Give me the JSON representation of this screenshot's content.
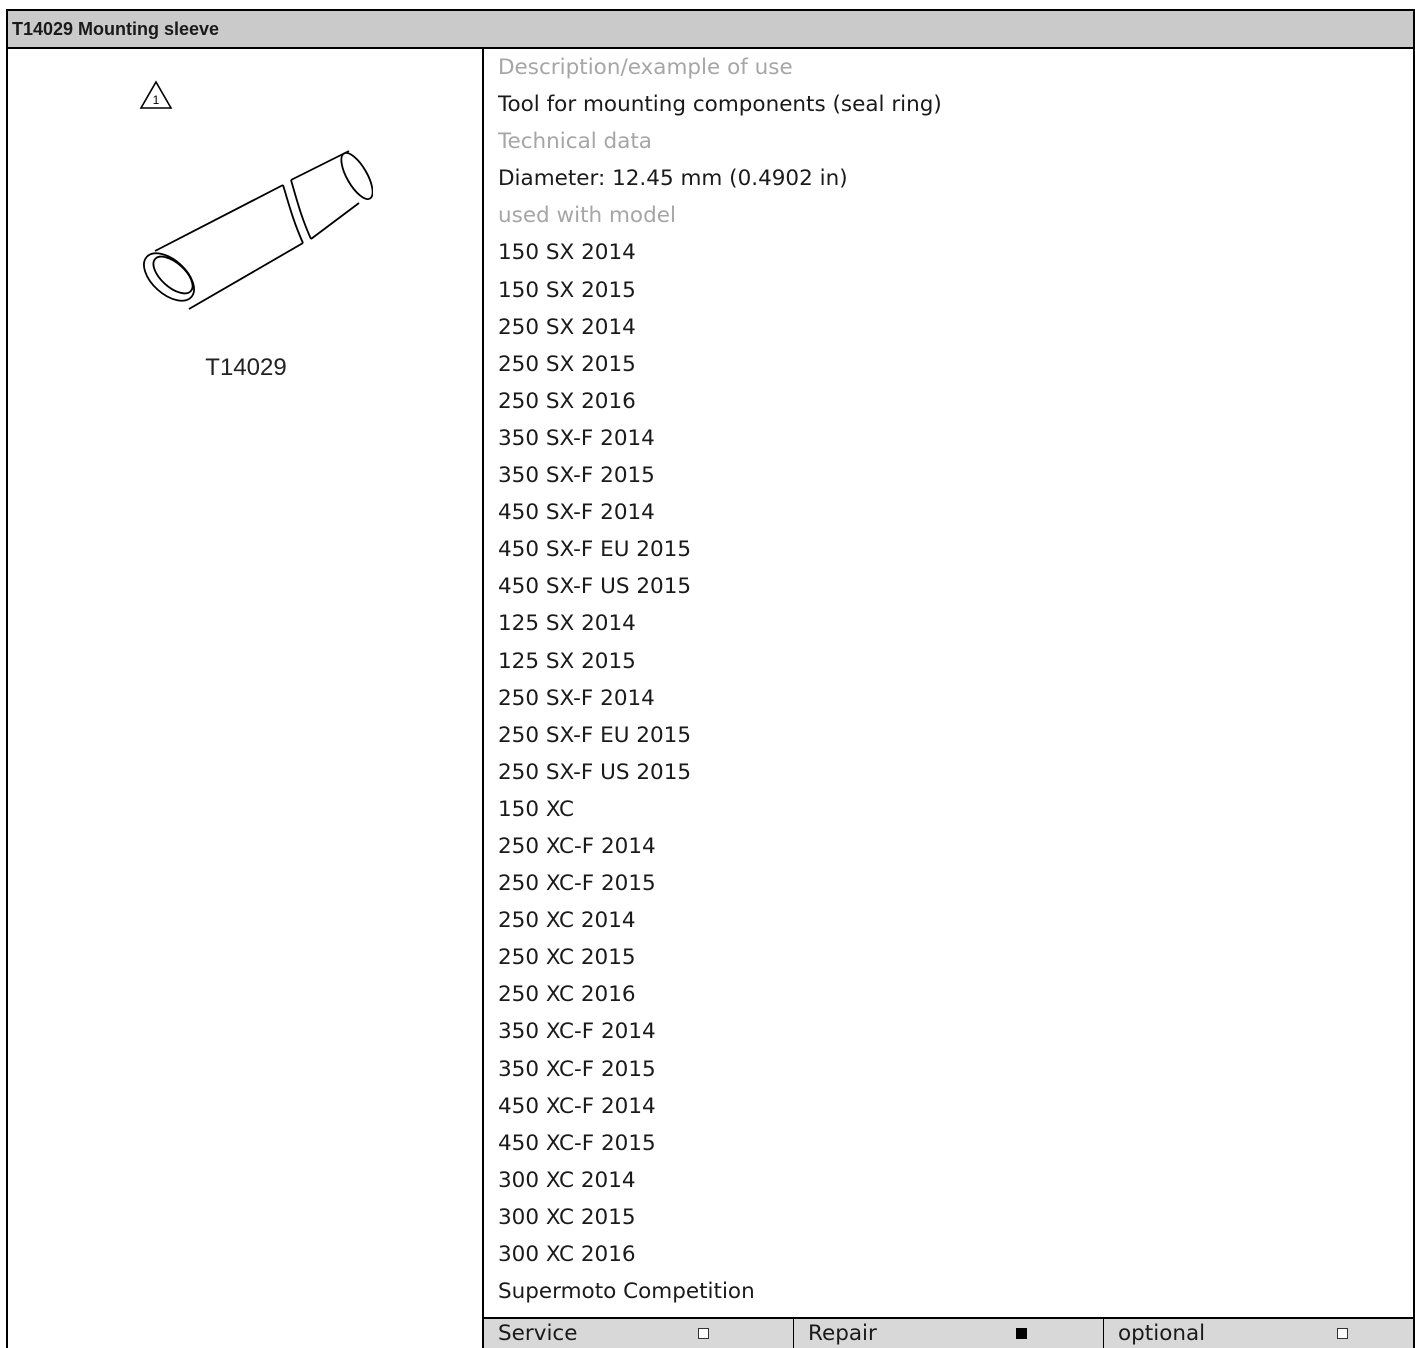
{
  "title": "T14029 Mounting sleeve",
  "image": {
    "label": "T14029",
    "warning_number": "1",
    "icons": [
      "warning-triangle-icon",
      "mounting-sleeve-drawing"
    ]
  },
  "details": {
    "rows": [
      {
        "text": "Description/example of use",
        "style": "heading"
      },
      {
        "text": "Tool for mounting components (seal ring)",
        "style": "body"
      },
      {
        "text": "Technical data",
        "style": "heading"
      },
      {
        "text": "Diameter: 12.45 mm (0.4902 in)",
        "style": "body"
      },
      {
        "text": "used with model",
        "style": "heading"
      },
      {
        "text": "150 SX 2014",
        "style": "body"
      },
      {
        "text": "150 SX 2015",
        "style": "body"
      },
      {
        "text": "250 SX 2014",
        "style": "body"
      },
      {
        "text": "250 SX 2015",
        "style": "body"
      },
      {
        "text": "250 SX 2016",
        "style": "body"
      },
      {
        "text": "350 SX-F 2014",
        "style": "body"
      },
      {
        "text": "350 SX-F 2015",
        "style": "body"
      },
      {
        "text": "450 SX-F 2014",
        "style": "body"
      },
      {
        "text": "450 SX-F EU 2015",
        "style": "body"
      },
      {
        "text": "450 SX-F US 2015",
        "style": "body"
      },
      {
        "text": "125 SX 2014",
        "style": "body"
      },
      {
        "text": "125 SX 2015",
        "style": "body"
      },
      {
        "text": "250 SX-F 2014",
        "style": "body"
      },
      {
        "text": "250 SX-F EU 2015",
        "style": "body"
      },
      {
        "text": "250 SX-F US 2015",
        "style": "body"
      },
      {
        "text": "150 XC",
        "style": "body"
      },
      {
        "text": "250 XC-F 2014",
        "style": "body"
      },
      {
        "text": "250 XC-F 2015",
        "style": "body"
      },
      {
        "text": "250 XC 2014",
        "style": "body"
      },
      {
        "text": "250 XC 2015",
        "style": "body"
      },
      {
        "text": "250 XC 2016",
        "style": "body"
      },
      {
        "text": "350 XC-F 2014",
        "style": "body"
      },
      {
        "text": "350 XC-F 2015",
        "style": "body"
      },
      {
        "text": "450 XC-F 2014",
        "style": "body"
      },
      {
        "text": "450 XC-F 2015",
        "style": "body"
      },
      {
        "text": "300 XC 2014",
        "style": "body"
      },
      {
        "text": "300 XC 2015",
        "style": "body"
      },
      {
        "text": "300 XC 2016",
        "style": "body"
      },
      {
        "text": "Supermoto Competition",
        "style": "body"
      }
    ]
  },
  "footer": {
    "items": [
      {
        "label": "Service",
        "checked": false
      },
      {
        "label": "Repair",
        "checked": true
      },
      {
        "label": "optional",
        "checked": false
      }
    ]
  }
}
